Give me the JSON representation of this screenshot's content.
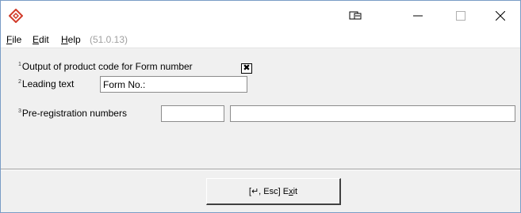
{
  "titlebar": {
    "app_icon": "diamond-app-icon",
    "restore_icon": "restore-window-icon",
    "minimize_icon": "minimize-icon",
    "maximize_icon": "maximize-icon",
    "close_icon": "close-icon"
  },
  "menu": {
    "file": {
      "mnemonic": "F",
      "rest": "ile"
    },
    "edit": {
      "mnemonic": "E",
      "rest": "dit"
    },
    "help": {
      "mnemonic": "H",
      "rest": "elp"
    },
    "version": "(51.0.13)"
  },
  "form": {
    "row1": {
      "num": "1",
      "label": "Output of product code for Form number",
      "checked": true,
      "check_mark": "✖"
    },
    "row2": {
      "num": "2",
      "label": "Leading text",
      "value": "Form No.:"
    },
    "row3": {
      "num": "3",
      "label": "Pre-registration numbers",
      "value1": "",
      "value2": ""
    }
  },
  "footer": {
    "exit_prefix": "[↵, Esc] E",
    "exit_mnemonic": "x",
    "exit_suffix": "it"
  },
  "colors": {
    "brand_icon": "#d13b2a",
    "window_bg": "#f0f0f0",
    "version_text": "#a0a0a0"
  }
}
